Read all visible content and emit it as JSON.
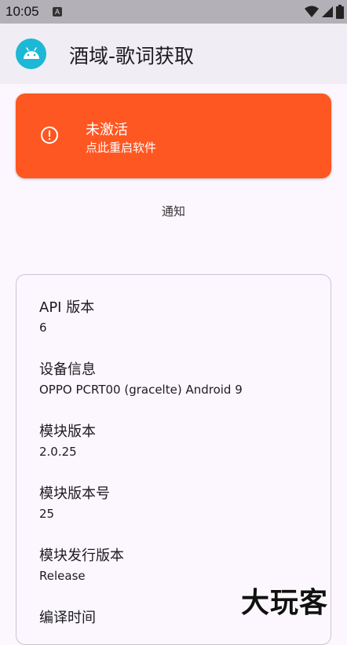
{
  "status_bar": {
    "time": "10:05",
    "notification_icon": "keyboard-a-icon",
    "icons": [
      "wifi-icon",
      "signal-icon",
      "battery-icon"
    ]
  },
  "app_bar": {
    "title": "酒域-歌词获取",
    "logo_icon": "android-icon"
  },
  "warning_card": {
    "title": "未激活",
    "subtitle": "点此重启软件",
    "icon": "alert-circle-icon",
    "color": "#FF5722"
  },
  "notify_button": {
    "label": "通知"
  },
  "info": {
    "items": [
      {
        "label": "API 版本",
        "value": "6"
      },
      {
        "label": "设备信息",
        "value": "OPPO PCRT00 (gracelte) Android 9"
      },
      {
        "label": "模块版本",
        "value": "2.0.25"
      },
      {
        "label": "模块版本号",
        "value": "25"
      },
      {
        "label": "模块发行版本",
        "value": "Release"
      },
      {
        "label": "编译时间",
        "value": ""
      }
    ]
  },
  "watermark": {
    "text": "大玩客"
  }
}
